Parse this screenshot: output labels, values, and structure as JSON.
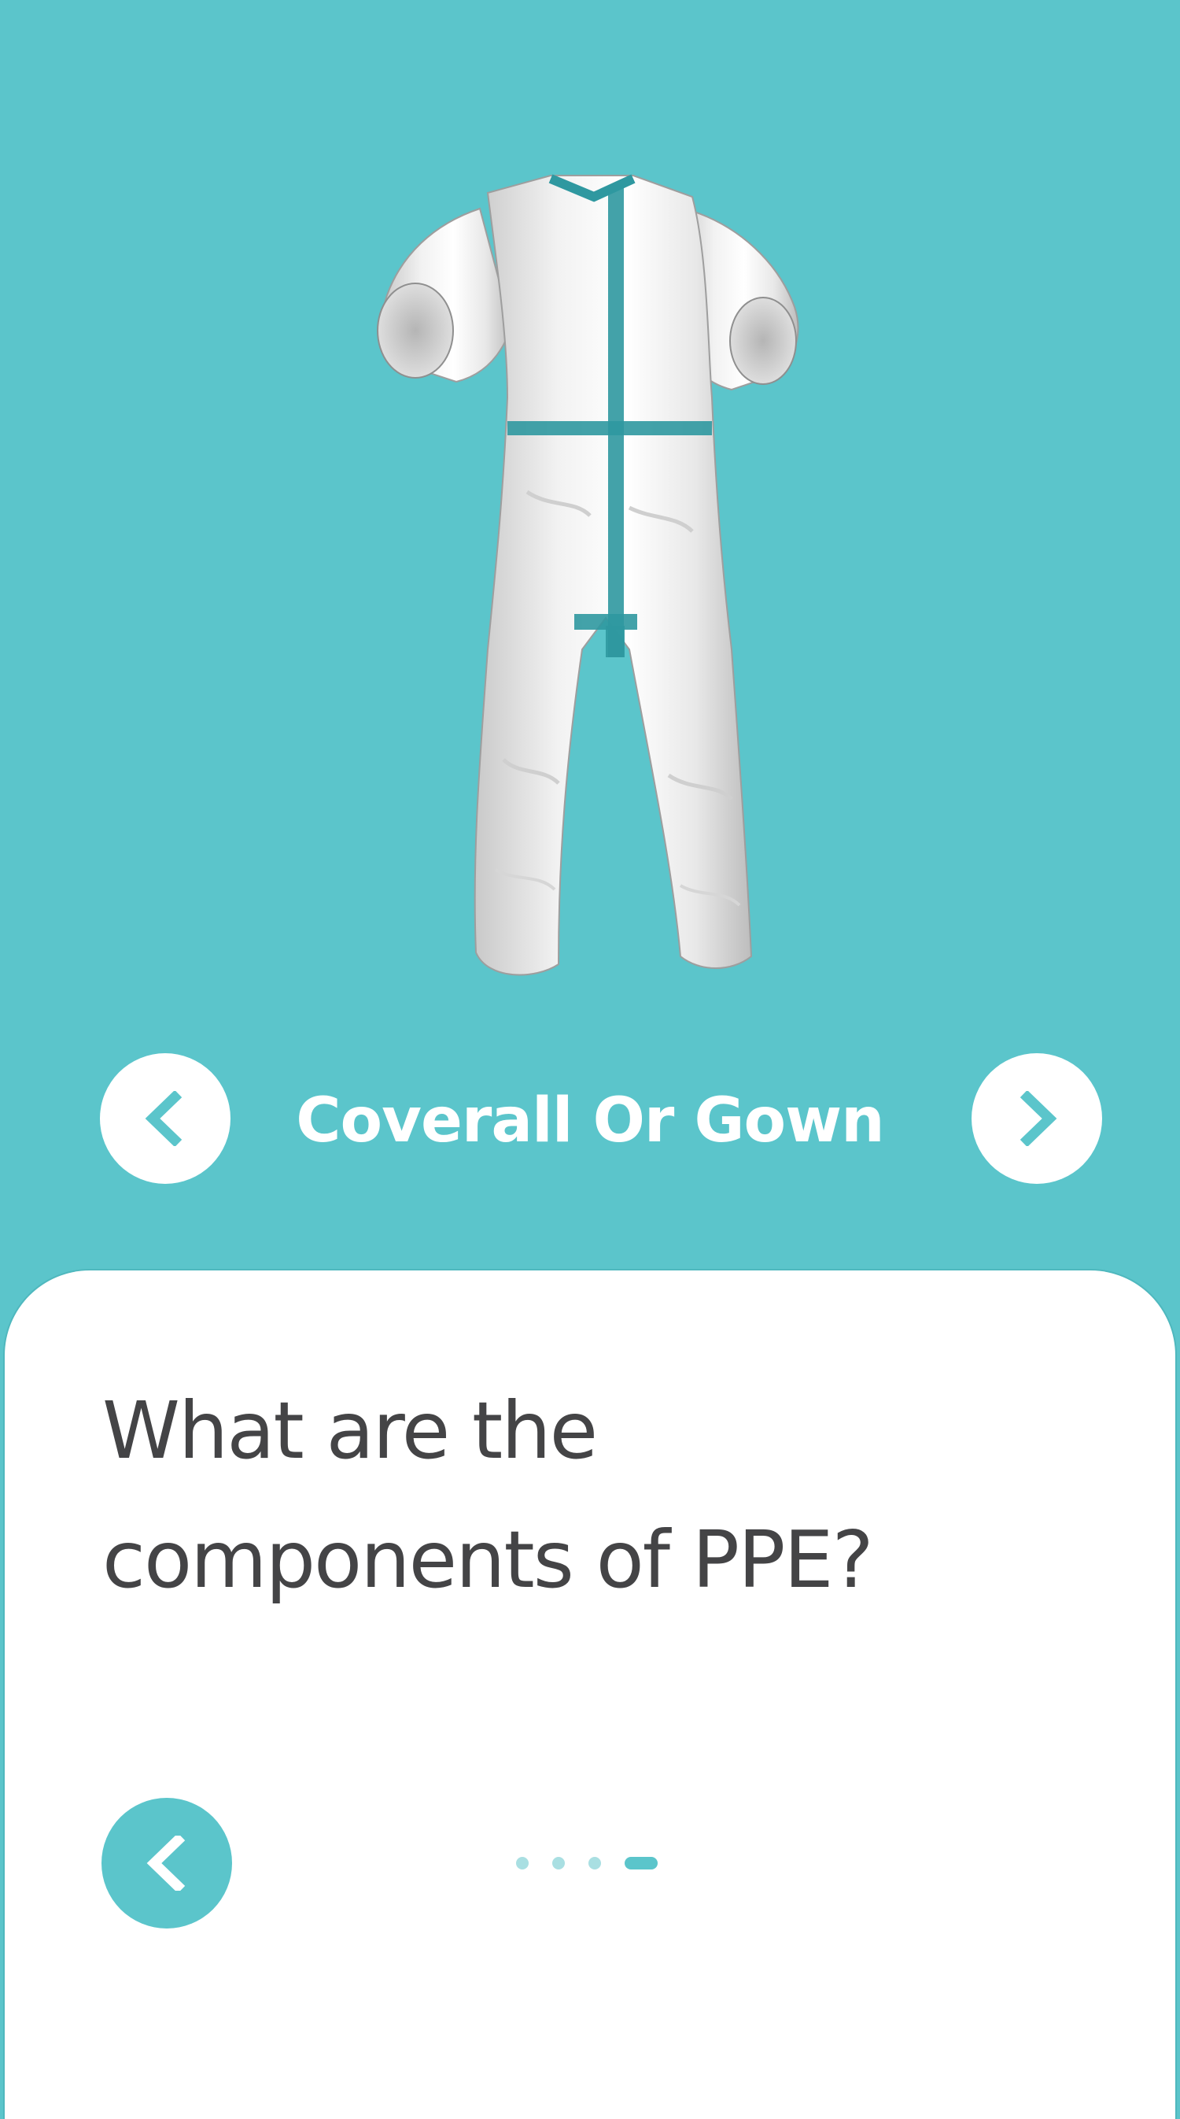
{
  "hero": {
    "image_name": "coverall-suit-image",
    "item_title": "Coverall Or Gown",
    "prev_icon": "chevron-left-icon",
    "next_icon": "chevron-right-icon"
  },
  "card": {
    "question_line1": "What are the",
    "question_line2": "components of PPE?",
    "back_icon": "chevron-left-icon",
    "pager": {
      "total": 4,
      "current": 4
    }
  },
  "colors": {
    "accent": "#5bc5cb",
    "text": "#444446",
    "dot_inactive": "#a9dfe2",
    "tape": "#2f98a0"
  }
}
